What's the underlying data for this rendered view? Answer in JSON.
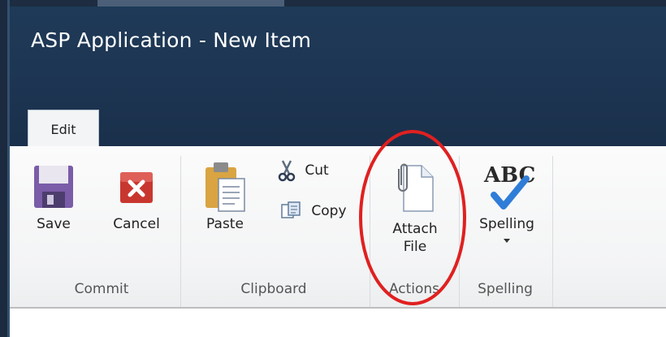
{
  "window": {
    "title": "ASP Application - New Item"
  },
  "ribbon": {
    "active_tab": "Edit",
    "groups": {
      "commit": {
        "label": "Commit",
        "save_label": "Save",
        "cancel_label": "Cancel"
      },
      "clipboard": {
        "label": "Clipboard",
        "paste_label": "Paste",
        "cut_label": "Cut",
        "copy_label": "Copy"
      },
      "actions": {
        "label": "Actions",
        "attach_line1": "Attach",
        "attach_line2": "File"
      },
      "spelling": {
        "label": "Spelling",
        "spelling_label": "Spelling",
        "icon_text": "ABC"
      }
    }
  },
  "annotation": {
    "highlight_color": "#e02020",
    "highlighted": "attach-file-button"
  },
  "icons": [
    "save-icon",
    "cancel-icon",
    "paste-icon",
    "cut-icon",
    "copy-icon",
    "attach-file-icon",
    "spelling-icon",
    "dropdown-arrow-icon"
  ]
}
